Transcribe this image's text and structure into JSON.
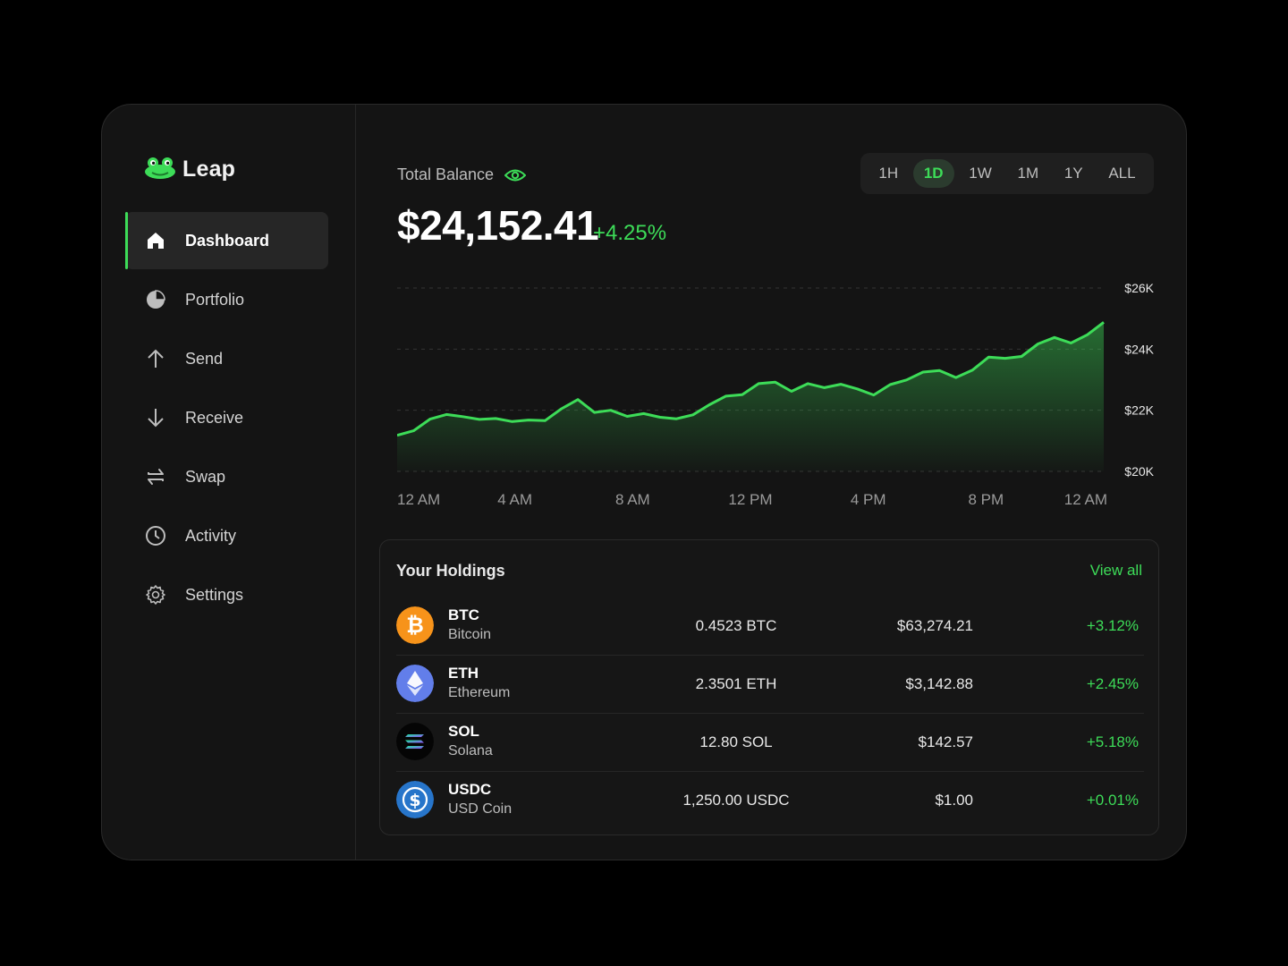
{
  "app": {
    "name": "Leap"
  },
  "sidebar": {
    "items": [
      {
        "label": "Dashboard",
        "icon": "home-icon",
        "active": true
      },
      {
        "label": "Portfolio",
        "icon": "pie-chart-icon",
        "active": false
      },
      {
        "label": "Send",
        "icon": "arrow-up-icon",
        "active": false
      },
      {
        "label": "Receive",
        "icon": "arrow-down-icon",
        "active": false
      },
      {
        "label": "Swap",
        "icon": "swap-icon",
        "active": false
      },
      {
        "label": "Activity",
        "icon": "clock-icon",
        "active": false
      },
      {
        "label": "Settings",
        "icon": "gear-icon",
        "active": false
      }
    ]
  },
  "balance": {
    "label": "Total Balance",
    "value": "$24,152.41",
    "change": "+4.25%"
  },
  "ranges": {
    "items": [
      "1H",
      "1D",
      "1W",
      "1M",
      "1Y",
      "ALL"
    ],
    "active": "1D"
  },
  "chart_data": {
    "type": "area",
    "ylim": [
      20000,
      26000
    ],
    "y_ticks": [
      20000,
      22000,
      24000,
      26000
    ],
    "y_tick_labels": [
      "$20K",
      "$22K",
      "$24K",
      "$26K"
    ],
    "x_tick_labels": [
      "12 AM",
      "4 AM",
      "8 AM",
      "12 PM",
      "4 PM",
      "8 PM",
      "12 AM"
    ],
    "grid": true,
    "color": "#3ddc58",
    "values": [
      21180,
      21330,
      21710,
      21860,
      21790,
      21700,
      21730,
      21630,
      21680,
      21660,
      22050,
      22350,
      21930,
      22000,
      21800,
      21890,
      21770,
      21720,
      21850,
      22180,
      22460,
      22510,
      22870,
      22920,
      22620,
      22870,
      22740,
      22850,
      22700,
      22500,
      22840,
      22990,
      23250,
      23300,
      23070,
      23310,
      23740,
      23700,
      23760,
      24170,
      24380,
      24200,
      24470,
      24880
    ]
  },
  "holdings": {
    "title": "Your Holdings",
    "view_all": "View all",
    "rows": [
      {
        "symbol": "BTC",
        "name": "Bitcoin",
        "amount": "0.4523 BTC",
        "price": "$63,274.21",
        "change": "+3.12%",
        "icon": "bitcoin-icon",
        "color": "#f7931a"
      },
      {
        "symbol": "ETH",
        "name": "Ethereum",
        "amount": "2.3501 ETH",
        "price": "$3,142.88",
        "change": "+2.45%",
        "icon": "ethereum-icon",
        "color": "#627eea"
      },
      {
        "symbol": "SOL",
        "name": "Solana",
        "amount": "12.80 SOL",
        "price": "$142.57",
        "change": "+5.18%",
        "icon": "solana-icon",
        "color": "#000000"
      },
      {
        "symbol": "USDC",
        "name": "USD Coin",
        "amount": "1,250.00 USDC",
        "price": "$1.00",
        "change": "+0.01%",
        "icon": "usdc-icon",
        "color": "#2775ca"
      }
    ]
  },
  "colors": {
    "accent": "#3ddc58",
    "background": "#141414",
    "surface": "#1f1f1f"
  }
}
